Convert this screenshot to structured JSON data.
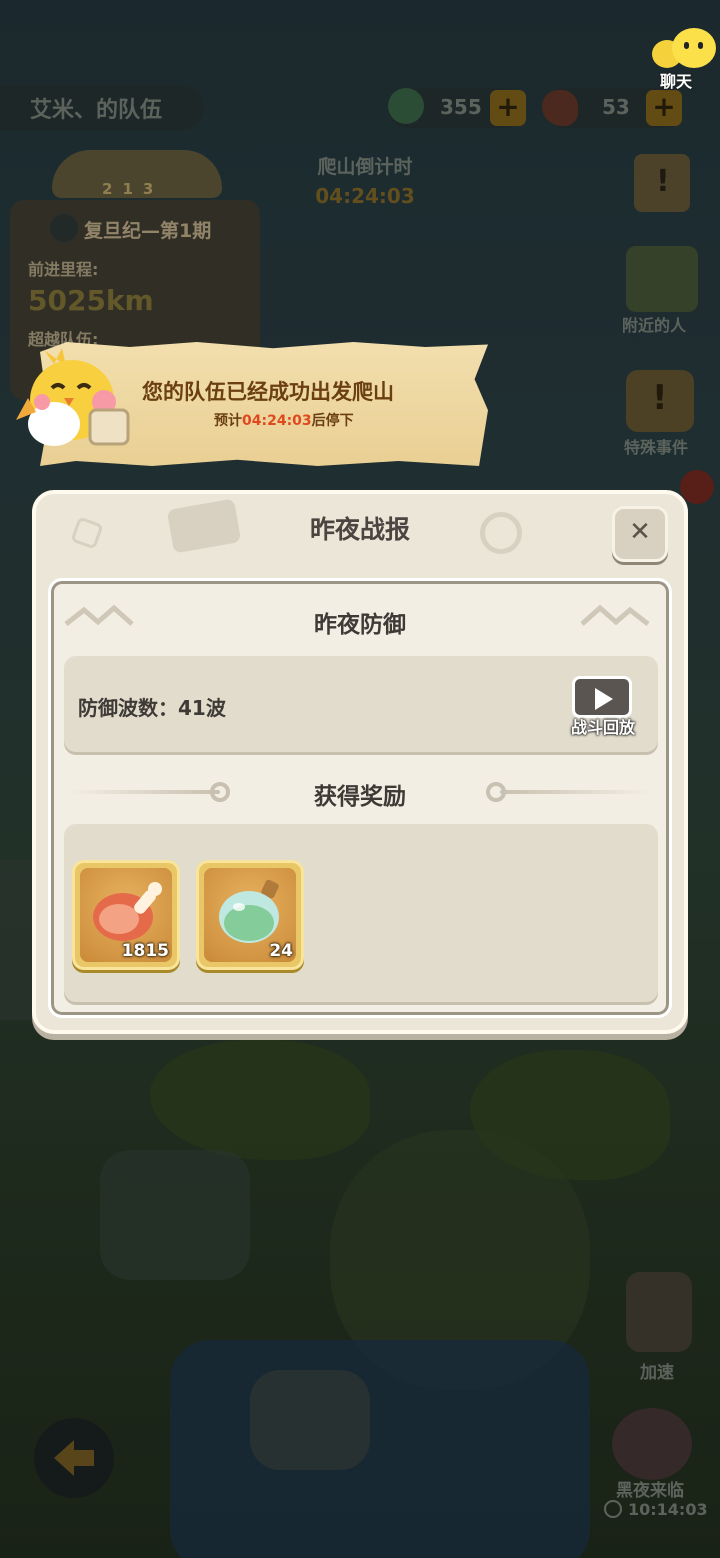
{
  "top": {
    "team_name": "艾米、的队伍",
    "resources": [
      {
        "icon": "potion-icon",
        "value": "355"
      },
      {
        "icon": "meat-icon",
        "value": "53"
      }
    ],
    "chat_label": "聊天",
    "plus_symbol": "+"
  },
  "climb": {
    "countdown_label": "爬山倒计时",
    "countdown_value": "04:24:03"
  },
  "season": {
    "rank_digits": [
      "2",
      "1",
      "3"
    ],
    "title": "复旦纪—第1期",
    "distance_label": "前进里程:",
    "distance_value": "5025km",
    "team_label": "超越队伍:"
  },
  "side_buttons": {
    "nearby": "附近的人",
    "special_event": "特殊事件",
    "speed_up": "加速",
    "night_falls": "黑夜来临",
    "night_timer": "10:14:03"
  },
  "toast": {
    "title": "您的队伍已经成功出发爬山",
    "sub_prefix": "预计",
    "sub_time": "04:24:03",
    "sub_suffix": "后停下"
  },
  "dialog": {
    "title": "昨夜战报",
    "close_symbol": "✕",
    "defense_heading": "昨夜防御",
    "wave_text": "防御波数：41波",
    "replay_label": "战斗回放",
    "reward_heading": "获得奖励",
    "rewards": [
      {
        "icon": "meat-icon",
        "count": "1815"
      },
      {
        "icon": "potion-icon",
        "count": "24"
      }
    ]
  },
  "colors": {
    "accent_gold": "#e9c766",
    "toast_time": "#e0491d",
    "panel_bg": "#ece6d8"
  }
}
